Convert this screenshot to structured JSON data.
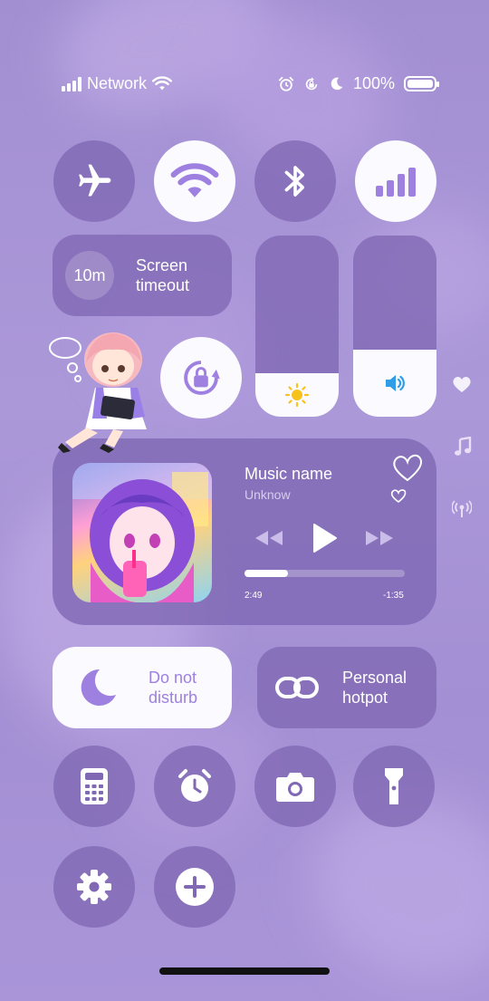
{
  "status_bar": {
    "network_label": "Network",
    "battery_text": "100%"
  },
  "quick_toggles": [
    {
      "name": "airplane-mode",
      "active": false
    },
    {
      "name": "wifi",
      "active": true
    },
    {
      "name": "bluetooth",
      "active": false
    },
    {
      "name": "cellular-data",
      "active": true
    }
  ],
  "screen_timeout": {
    "value": "10m",
    "label_line1": "Screen",
    "label_line2": "timeout"
  },
  "brightness": {
    "level": 0.24,
    "icon": "sun-icon"
  },
  "volume": {
    "level": 0.37,
    "icon": "speaker-icon"
  },
  "rotation_lock": {
    "active": true
  },
  "media": {
    "title": "Music name",
    "artist": "Unknow",
    "elapsed": "2:49",
    "remaining": "-1:35",
    "progress": 0.27
  },
  "do_not_disturb": {
    "label_line1": "Do not",
    "label_line2": "disturb",
    "active": true
  },
  "hotspot": {
    "label_line1": "Personal",
    "label_line2": "hotpot",
    "active": false
  },
  "shortcuts": [
    "calculator-icon",
    "alarm-clock-icon",
    "camera-icon",
    "flashlight-icon",
    "settings-icon",
    "add-icon"
  ],
  "side_icons": [
    "heart-icon",
    "music-note-icon",
    "broadcast-icon"
  ],
  "colors": {
    "accent": "#9e80e0",
    "tile": "#8068b4",
    "active_tile": "#fbfafe",
    "sun": "#f6c21b",
    "speaker": "#2f9ee6"
  }
}
